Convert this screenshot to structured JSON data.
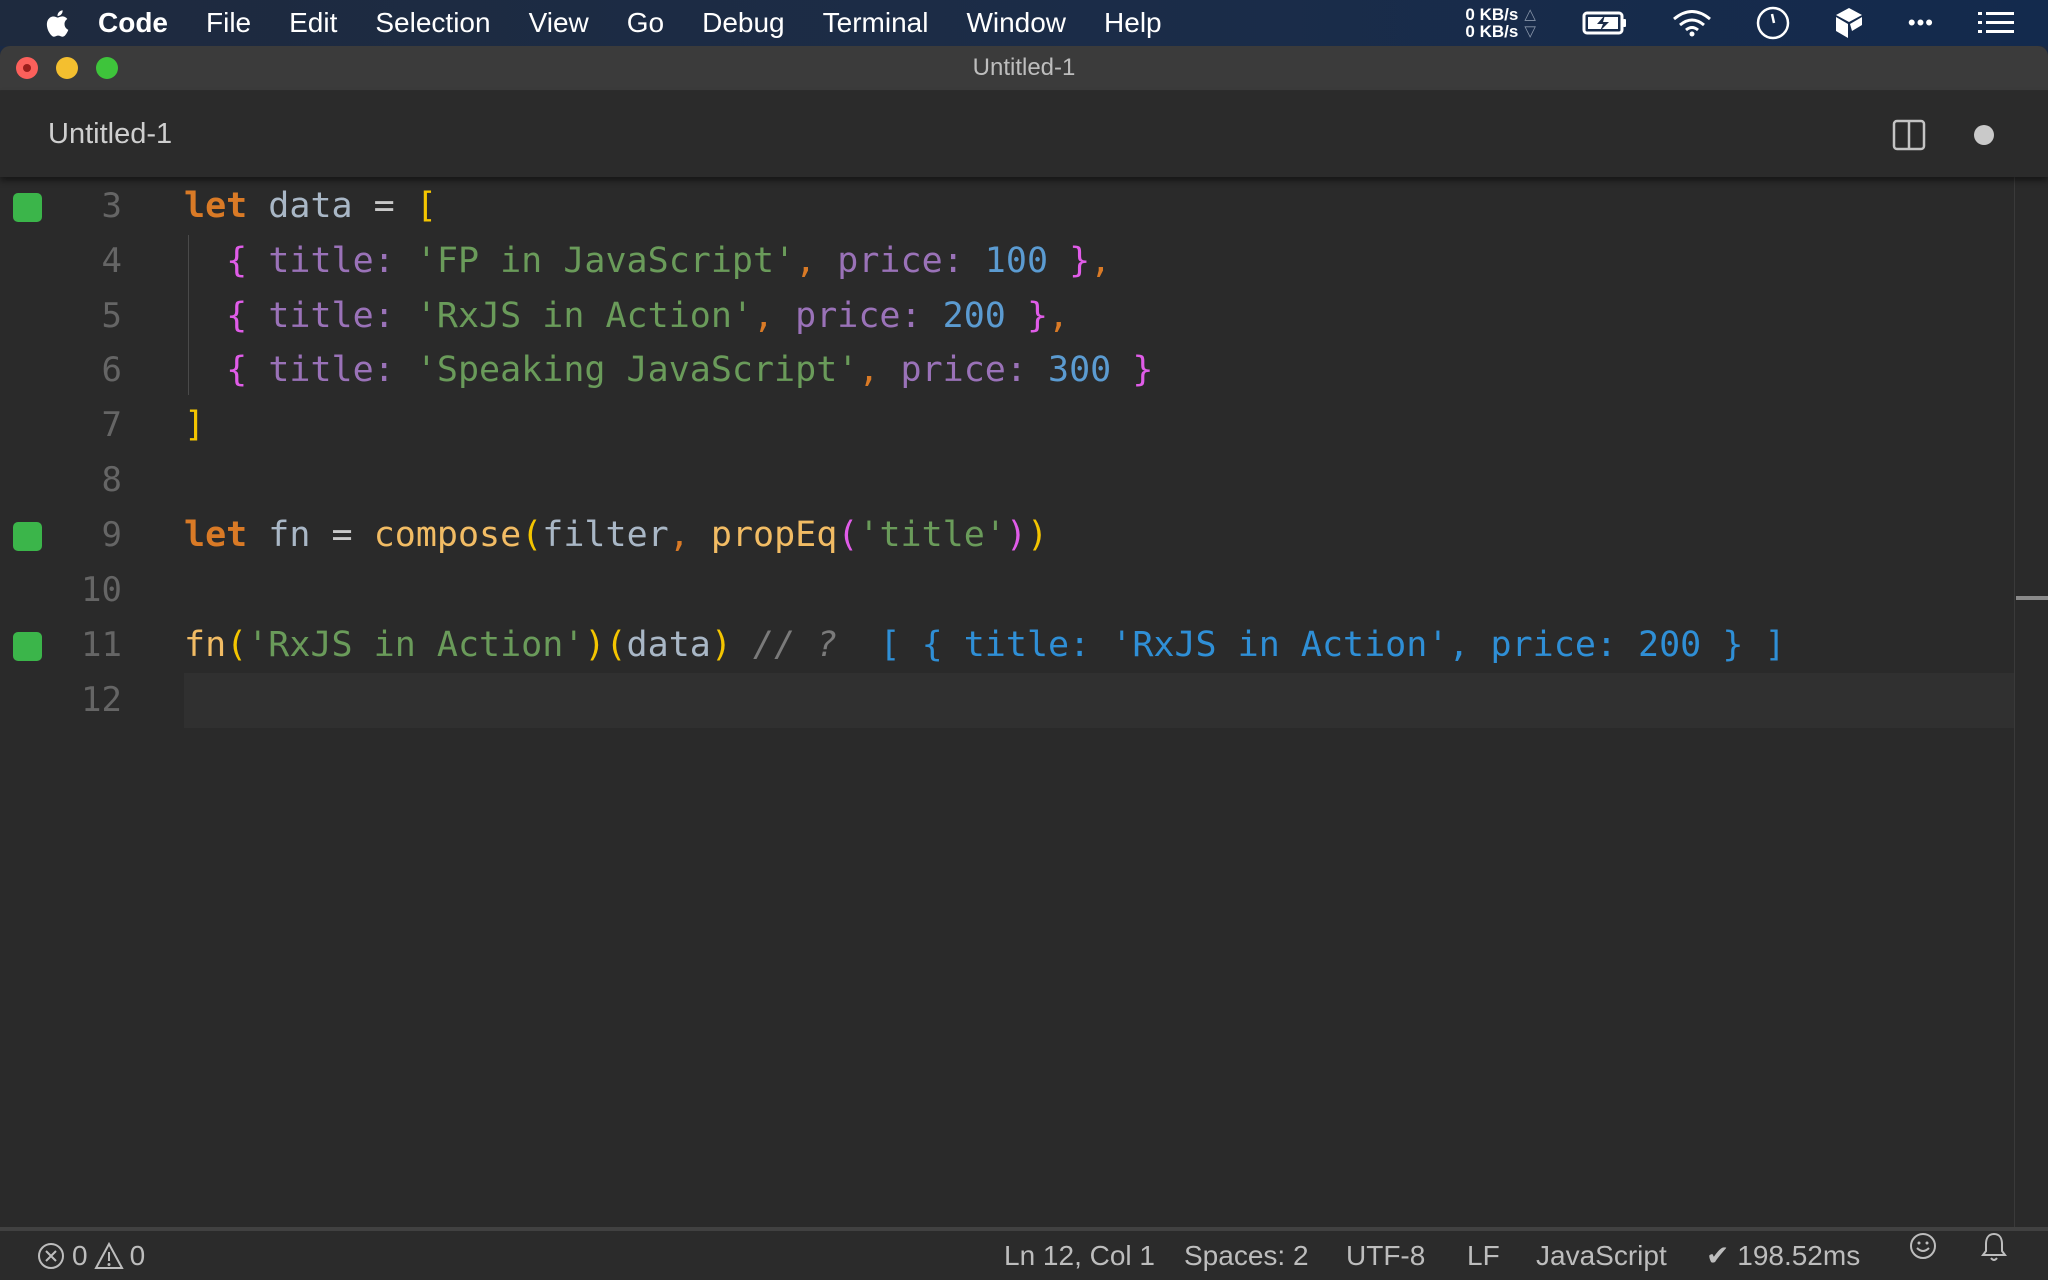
{
  "menubar": {
    "app": "Code",
    "items": [
      "File",
      "Edit",
      "Selection",
      "View",
      "Go",
      "Debug",
      "Terminal",
      "Window",
      "Help"
    ],
    "net_up": "0 KB/s",
    "net_down": "0 KB/s",
    "net_up_arrow": "△",
    "net_down_arrow": "▽",
    "more": "•••"
  },
  "window": {
    "title": "Untitled-1",
    "tab_label": "Untitled-1"
  },
  "editor": {
    "lines": [
      {
        "num": "3",
        "marker": true
      },
      {
        "num": "4",
        "marker": false
      },
      {
        "num": "5",
        "marker": false
      },
      {
        "num": "6",
        "marker": false
      },
      {
        "num": "7",
        "marker": false
      },
      {
        "num": "8",
        "marker": false
      },
      {
        "num": "9",
        "marker": true
      },
      {
        "num": "10",
        "marker": false
      },
      {
        "num": "11",
        "marker": true
      },
      {
        "num": "12",
        "marker": false
      }
    ],
    "tokens": {
      "let": "let",
      "data": "data",
      "eq": "=",
      "lbracket": "[",
      "rbracket": "]",
      "lbrace": "{",
      "rbrace": "}",
      "title_key": "title",
      "price_key": "price",
      "colon": ":",
      "comma": ",",
      "book1": "'FP in JavaScript'",
      "book2": "'RxJS in Action'",
      "book3": "'Speaking JavaScript'",
      "price1": "100",
      "price2": "200",
      "price3": "300",
      "fn": "fn",
      "compose": "compose",
      "filter": "filter",
      "propEq": "propEq",
      "title_str": "'title'",
      "lparen": "(",
      "rparen": ")",
      "comment": "// ?",
      "result": "[ { title: 'RxJS in Action', price: 200 } ]"
    }
  },
  "statusbar": {
    "errors": "0",
    "warnings": "0",
    "position": "Ln 12, Col 1",
    "spaces": "Spaces: 2",
    "encoding": "UTF-8",
    "eol": "LF",
    "language": "JavaScript",
    "timing": "✔ 198.52ms"
  }
}
